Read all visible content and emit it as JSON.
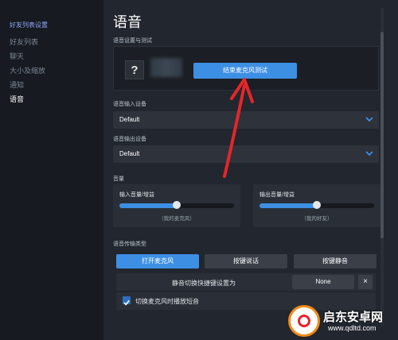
{
  "sidebar": {
    "title": "好友列表设置",
    "items": [
      {
        "label": "好友列表"
      },
      {
        "label": "聊天"
      },
      {
        "label": "大小及缩放"
      },
      {
        "label": "通知"
      },
      {
        "label": "语音"
      }
    ],
    "active_index": 4
  },
  "page": {
    "title": "语音"
  },
  "test": {
    "section_label": "语音设置与测试",
    "avatar_glyph": "?",
    "button_label": "结束麦克风测试"
  },
  "input_device": {
    "label": "语音输入设备",
    "value": "Default"
  },
  "output_device": {
    "label": "语音输出设备",
    "value": "Default"
  },
  "volume": {
    "section_label": "音量",
    "input": {
      "label": "输入音量/增益",
      "sublabel": "（我的麦克风）",
      "level": 0.5
    },
    "output": {
      "label": "输出音量/增益",
      "sublabel": "（我的好友）",
      "level": 0.5
    }
  },
  "transmission": {
    "section_label": "语音传输类型",
    "tabs": [
      {
        "label": "打开麦克风",
        "active": true
      },
      {
        "label": "按键说话",
        "active": false
      },
      {
        "label": "按键静音",
        "active": false
      }
    ],
    "hotkey_label": "静音切换快捷键设置为",
    "hotkey_value": "None",
    "clear_glyph": "×",
    "checkbox_label": "切换麦克风时播放短音",
    "checkbox_checked": true
  },
  "watermark": {
    "title": "启东安卓网",
    "url": "www.qdltd.com"
  },
  "colors": {
    "accent": "#3d8fe4",
    "annotation_arrow": "#e5262b"
  }
}
